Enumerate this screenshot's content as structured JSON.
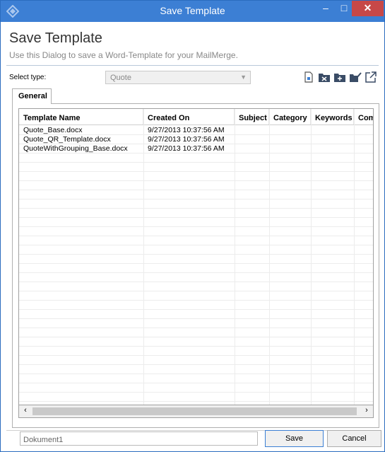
{
  "window": {
    "title": "Save Template",
    "controls": {
      "minimize": "–",
      "maximize": "□",
      "close": "✕"
    },
    "accent": "#3c7fd4"
  },
  "header": {
    "title": "Save Template",
    "subtitle": "Use this Dialog to save a Word-Template for your MailMerge."
  },
  "type_selector": {
    "label": "Select type:",
    "value": "Quote"
  },
  "toolbar": {
    "icons": [
      "new-document-icon",
      "delete-folder-icon",
      "add-folder-icon",
      "edit-folder-icon",
      "open-external-icon"
    ]
  },
  "tabs": [
    {
      "label": "General"
    }
  ],
  "grid": {
    "columns": [
      "Template Name",
      "Created On",
      "Subject",
      "Category",
      "Keywords",
      "Comr"
    ],
    "rows": [
      [
        "Quote_Base.docx",
        "9/27/2013 10:37:56 AM",
        "",
        "",
        "",
        ""
      ],
      [
        "Quote_QR_Template.docx",
        "9/27/2013 10:37:56 AM",
        "",
        "",
        "",
        ""
      ],
      [
        "QuoteWithGrouping_Base.docx",
        "9/27/2013 10:37:56 AM",
        "",
        "",
        "",
        ""
      ]
    ]
  },
  "footer": {
    "document_name": "Dokument1",
    "save_label": "Save",
    "cancel_label": "Cancel"
  }
}
